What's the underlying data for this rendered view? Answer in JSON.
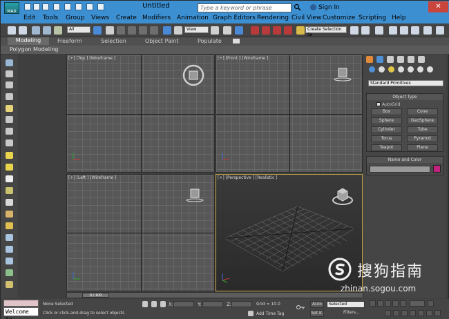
{
  "window": {
    "title": "Untitled",
    "search_placeholder": "Type a keyword or phrase",
    "signin": "Sign In",
    "close_glyph": "✕"
  },
  "menu": [
    "Edit",
    "Tools",
    "Group",
    "Views",
    "Create",
    "Modifiers",
    "Animation",
    "Graph Editors",
    "Rendering",
    "Civil View",
    "Customize",
    "Scripting",
    "Help"
  ],
  "toolbar": {
    "filter_value": "All",
    "view_value": "View",
    "selection_set_placeholder": "Create Selection Se"
  },
  "ribbon": {
    "tabs": [
      "Modeling",
      "Freeform",
      "Selection",
      "Object Paint",
      "Populate"
    ],
    "sub_label": "Polygon Modeling"
  },
  "viewports": {
    "top": "[+] [Top ] [Wireframe ]",
    "front": "[+] [Front ] [Wireframe ]",
    "left": "[+] [Left ] [Wireframe ]",
    "perspective": "[+] [Perspective ] [Realistic ]"
  },
  "command_panel": {
    "primitive_type": "Standard Primitives",
    "object_type_title": "Object Type",
    "autogrid_label": "AutoGrid",
    "buttons": [
      "Box",
      "Cone",
      "Sphere",
      "GeoSphere",
      "Cylinder",
      "Tube",
      "Torus",
      "Pyramid",
      "Teapot",
      "Plane"
    ],
    "name_color_title": "Name and Color",
    "color": "#c2227e"
  },
  "timeline": {
    "position": "0 / 100"
  },
  "status": {
    "welcome": "Welcome to",
    "selection_info": "None Selected",
    "prompt": "Click or click-and-drag to select objects",
    "x_label": "X:",
    "y_label": "Y:",
    "z_label": "Z:",
    "grid": "Grid = 10.0",
    "add_time_tag": "Add Time Tag",
    "auto": "Auto",
    "set_key": "Set K.",
    "selected": "Selected",
    "filters": "Filters..."
  },
  "watermark": {
    "text": "搜狗指南",
    "url": "zhinan.sogou.com"
  }
}
